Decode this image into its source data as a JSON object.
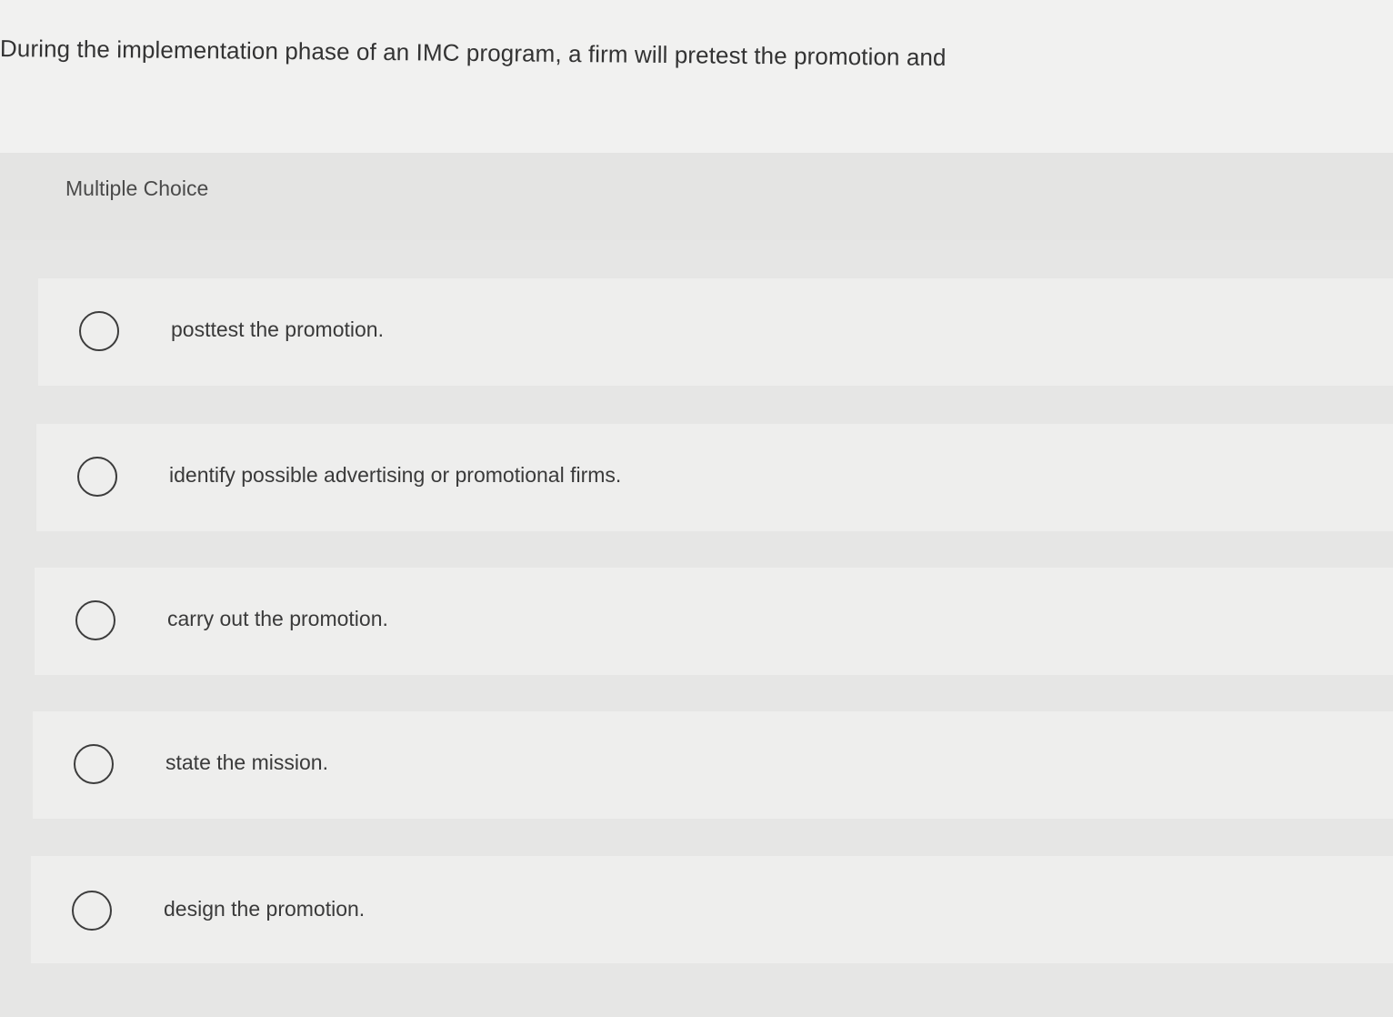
{
  "question": {
    "text": "During the implementation phase of an IMC program, a firm will pretest the promotion and"
  },
  "question_type": {
    "label": "Multiple Choice"
  },
  "options": [
    {
      "label": "posttest the promotion.",
      "selected": false,
      "icon": "radio-unchecked-icon"
    },
    {
      "label": "identify possible advertising or promotional firms.",
      "selected": false,
      "icon": "radio-unchecked-icon"
    },
    {
      "label": "carry out the promotion.",
      "selected": false,
      "icon": "radio-unchecked-icon"
    },
    {
      "label": "state the mission.",
      "selected": false,
      "icon": "radio-unchecked-icon"
    },
    {
      "label": "design the promotion.",
      "selected": false,
      "icon": "radio-unchecked-icon"
    }
  ],
  "colors": {
    "background": "#ebebea",
    "option_background": "#eeeeed",
    "header_background": "#e4e4e3",
    "text": "#3a3a3a",
    "radio_border": "#3c3c3c"
  }
}
